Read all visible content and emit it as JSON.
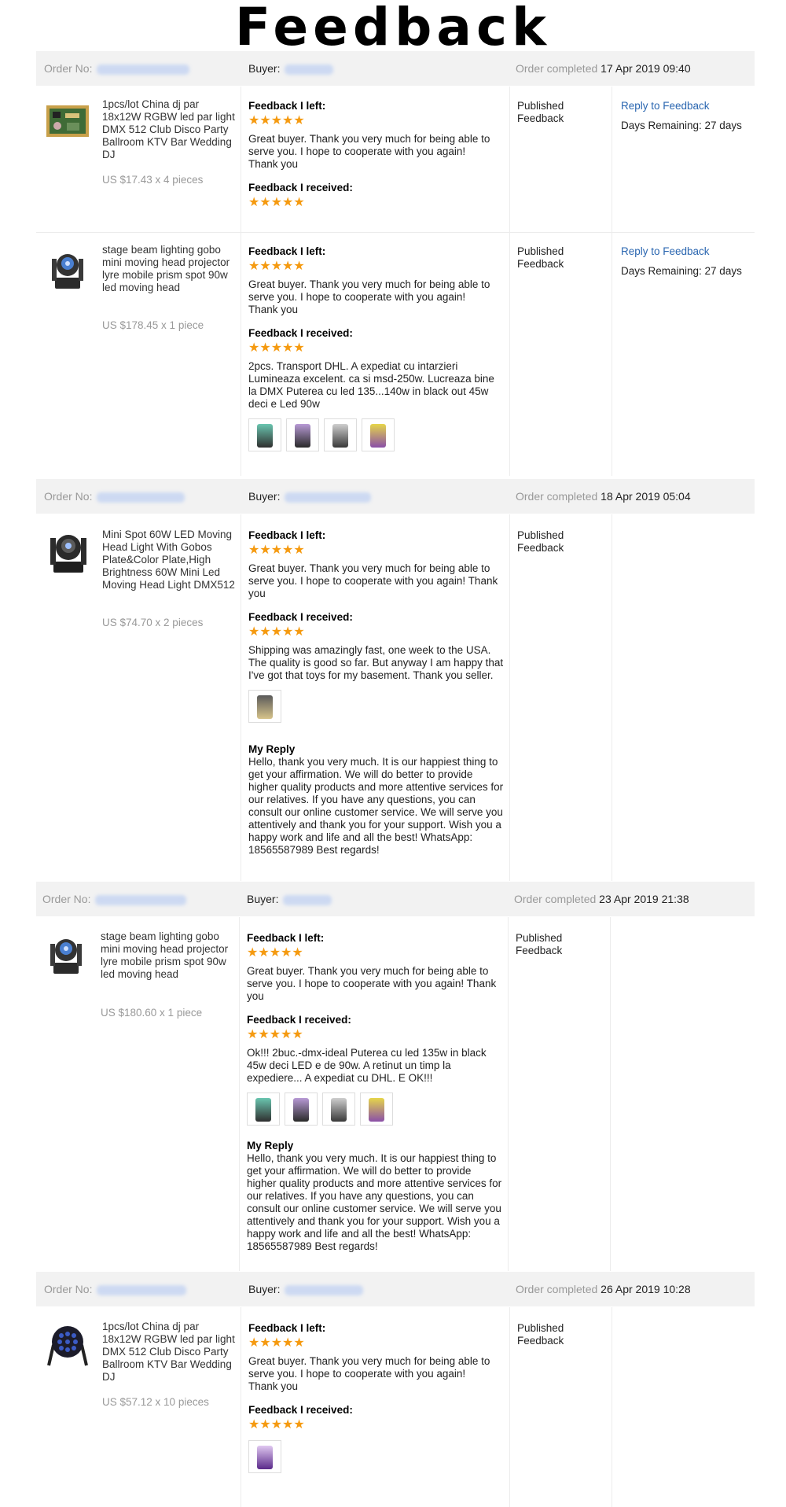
{
  "title": "Feedback",
  "labels": {
    "order_no": "Order No:",
    "buyer": "Buyer:",
    "order_completed": "Order completed",
    "feedback_left": "Feedback I left:",
    "feedback_received": "Feedback I received:",
    "status": "Published Feedback",
    "reply_to_feedback": "Reply to Feedback",
    "days_remaining": "Days Remaining: 27 days",
    "my_reply": "My Reply",
    "stars": "★★★★★"
  },
  "colors": {
    "accent": "#2a66b0",
    "stars": "#f59a10",
    "header_bg": "#f2f2f2"
  },
  "orders": [
    {
      "completed": "17 Apr 2019 09:40",
      "items": [
        {
          "title": "1pcs/lot China dj par 18x12W RGBW led par light DMX 512 Club Disco Party Ballroom KTV Bar Wedding DJ",
          "price": "US $17.43 x 4 pieces",
          "left_text": "Great buyer. Thank you very much for being able to serve you. I hope to cooperate with you again! Thank you",
          "received_text": ""
        },
        {
          "title": "stage beam lighting gobo mini moving head projector lyre mobile prism spot 90w led moving head",
          "price": "US $178.45 x 1 piece",
          "left_text": "Great buyer. Thank you very much for being able to serve you. I hope to cooperate with you again! Thank you",
          "received_text": "2pcs. Transport DHL. A expediat cu intarzieri Lumineaza excelent. ca si msd-250w. Lucreaza bine la DMX Puterea cu led 135...140w in black out 45w deci e Led 90w"
        }
      ]
    },
    {
      "completed": "18 Apr 2019 05:04",
      "items": [
        {
          "title": "Mini Spot 60W LED Moving Head Light With Gobos Plate&Color Plate,High Brightness 60W Mini Led Moving Head Light DMX512",
          "price": "US $74.70 x 2 pieces",
          "left_text": "Great buyer. Thank you very much for being able to serve you. I hope to cooperate with you again! Thank you",
          "received_text": "Shipping was amazingly fast, one week to the USA. The quality is good so far. But anyway I am happy that I've got that toys for my basement. Thank you seller.",
          "reply_text": "Hello, thank you very much. It is our happiest thing to get your affirmation. We will do better to provide higher quality products and more attentive services for our relatives. If you have any questions, you can consult our online customer service. We will serve you attentively and thank you for your support. Wish you a happy work and life and all the best! WhatsApp: 18565587989 Best regards!"
        }
      ]
    },
    {
      "completed": "23 Apr 2019 21:38",
      "items": [
        {
          "title": "stage beam lighting gobo mini moving head projector lyre mobile prism spot 90w led moving head",
          "price": "US $180.60 x 1 piece",
          "left_text": "Great buyer. Thank you very much for being able to serve you. I hope to cooperate with you again! Thank you",
          "received_text": "Ok!!! 2buc.-dmx-ideal Puterea cu led 135w in black 45w deci LED e de 90w. A retinut un timp la expediere... A expediat cu DHL. E OK!!!",
          "reply_text": "Hello, thank you very much. It is our happiest thing to get your affirmation. We will do better to provide higher quality products and more attentive services for our relatives. If you have any questions, you can consult our online customer service. We will serve you attentively and thank you for your support. Wish you a happy work and life and all the best! WhatsApp: 18565587989 Best regards!"
        }
      ]
    },
    {
      "completed": "26 Apr 2019 10:28",
      "items": [
        {
          "title": "1pcs/lot China dj par 18x12W RGBW led par light DMX 512 Club Disco Party Ballroom KTV Bar Wedding DJ",
          "price": "US $57.12 x 10 pieces",
          "left_text": "Great buyer. Thank you very much for being able to serve you. I hope to cooperate with you again! Thank you",
          "received_text": ""
        }
      ]
    }
  ]
}
